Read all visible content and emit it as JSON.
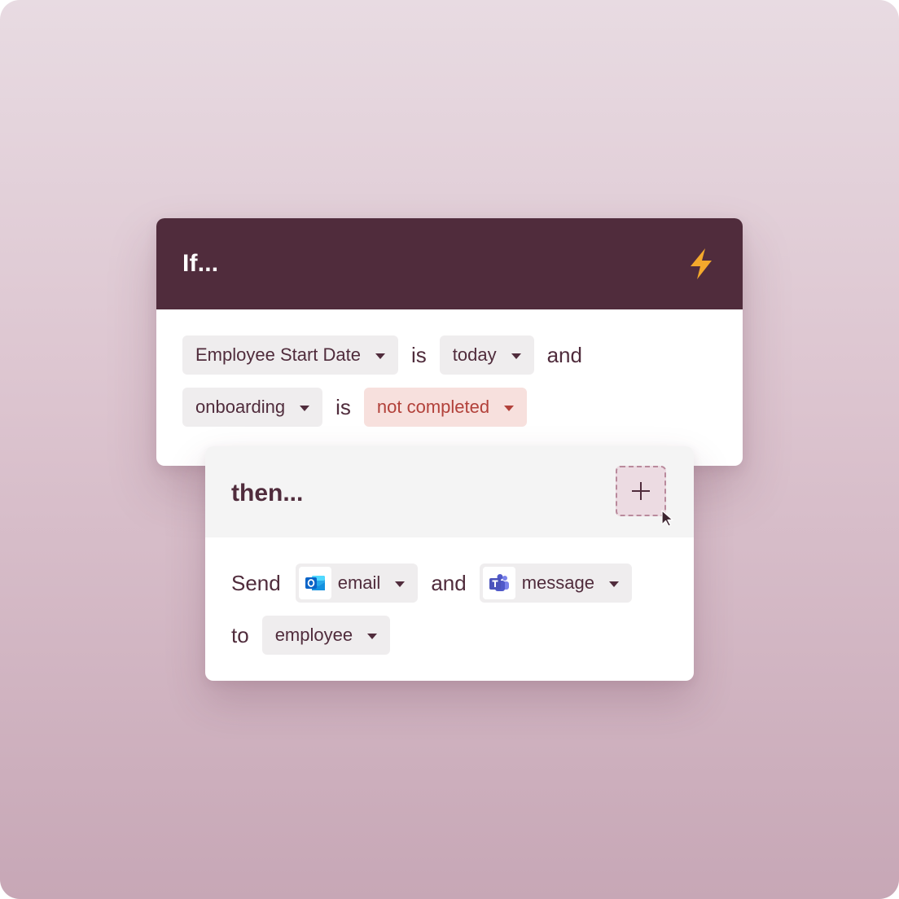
{
  "if_card": {
    "title": "If...",
    "trigger_icon": "lightning-bolt-icon",
    "row1": {
      "field": "Employee Start Date",
      "operator": "is",
      "value": "today",
      "conjunction": "and"
    },
    "row2": {
      "field": "onboarding",
      "operator": "is",
      "value": "not completed"
    }
  },
  "then_card": {
    "title": "then...",
    "add_icon": "plus-icon",
    "row1": {
      "verb": "Send",
      "channel1": "email",
      "channel1_icon": "outlook-icon",
      "conjunction": "and",
      "channel2": "message",
      "channel2_icon": "teams-icon"
    },
    "row2": {
      "preposition": "to",
      "recipient": "employee"
    }
  },
  "colors": {
    "header_dark": "#502c3c",
    "accent_bolt": "#f4a92c",
    "danger_text": "#b2413a",
    "danger_bg": "#f7e0dd",
    "chip_bg": "#efedee"
  }
}
